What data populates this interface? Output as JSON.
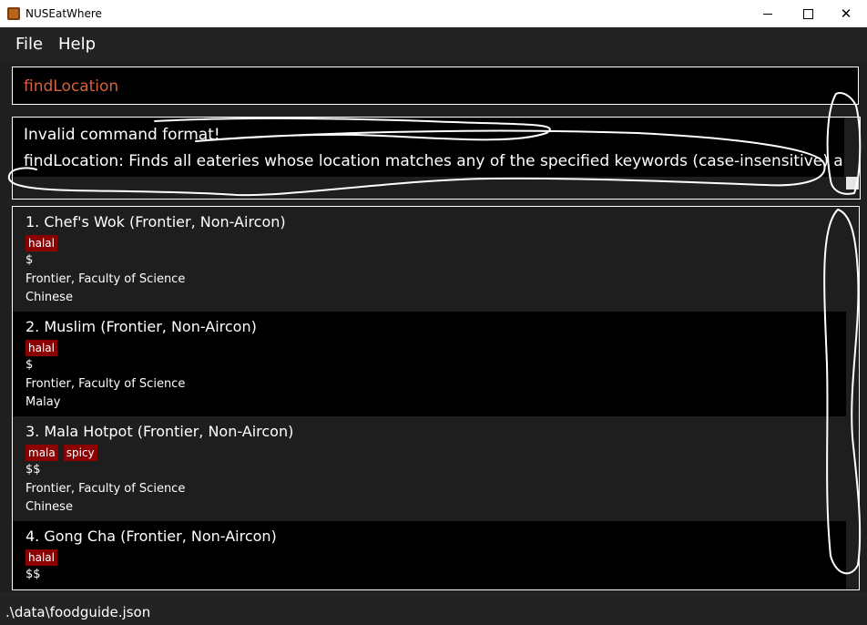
{
  "window": {
    "title": "NUSEatWhere",
    "icon": "app-icon",
    "controls": [
      "minimize-icon",
      "maximize-icon",
      "close-icon"
    ]
  },
  "menu": {
    "file": "File",
    "help": "Help"
  },
  "command": {
    "value": "findLocation",
    "color": "#d9603b"
  },
  "result": {
    "line1": "Invalid command format!",
    "line2": "findLocation: Finds all eateries whose location matches any of the specified keywords (case-insensitive) and di"
  },
  "eateries": [
    {
      "title": "1.  Chef's Wok (Frontier, Non-Aircon)",
      "tags": [
        "halal"
      ],
      "price": "$",
      "location": "Frontier, Faculty of Science",
      "cuisine": "Chinese"
    },
    {
      "title": "2.  Muslim (Frontier, Non-Aircon)",
      "tags": [
        "halal"
      ],
      "price": "$",
      "location": "Frontier, Faculty of Science",
      "cuisine": "Malay"
    },
    {
      "title": "3.  Mala Hotpot (Frontier, Non-Aircon)",
      "tags": [
        "mala",
        "spicy"
      ],
      "price": "$$",
      "location": "Frontier, Faculty of Science",
      "cuisine": "Chinese"
    },
    {
      "title": "4.  Gong Cha (Frontier, Non-Aircon)",
      "tags": [
        "halal"
      ],
      "price": "$$",
      "location": "",
      "cuisine": ""
    }
  ],
  "status": {
    "path": ".\\data\\foodguide.json"
  },
  "colors": {
    "background": "#1f1f1f",
    "tag": "#8b0000",
    "annotation": "#ffffff"
  }
}
